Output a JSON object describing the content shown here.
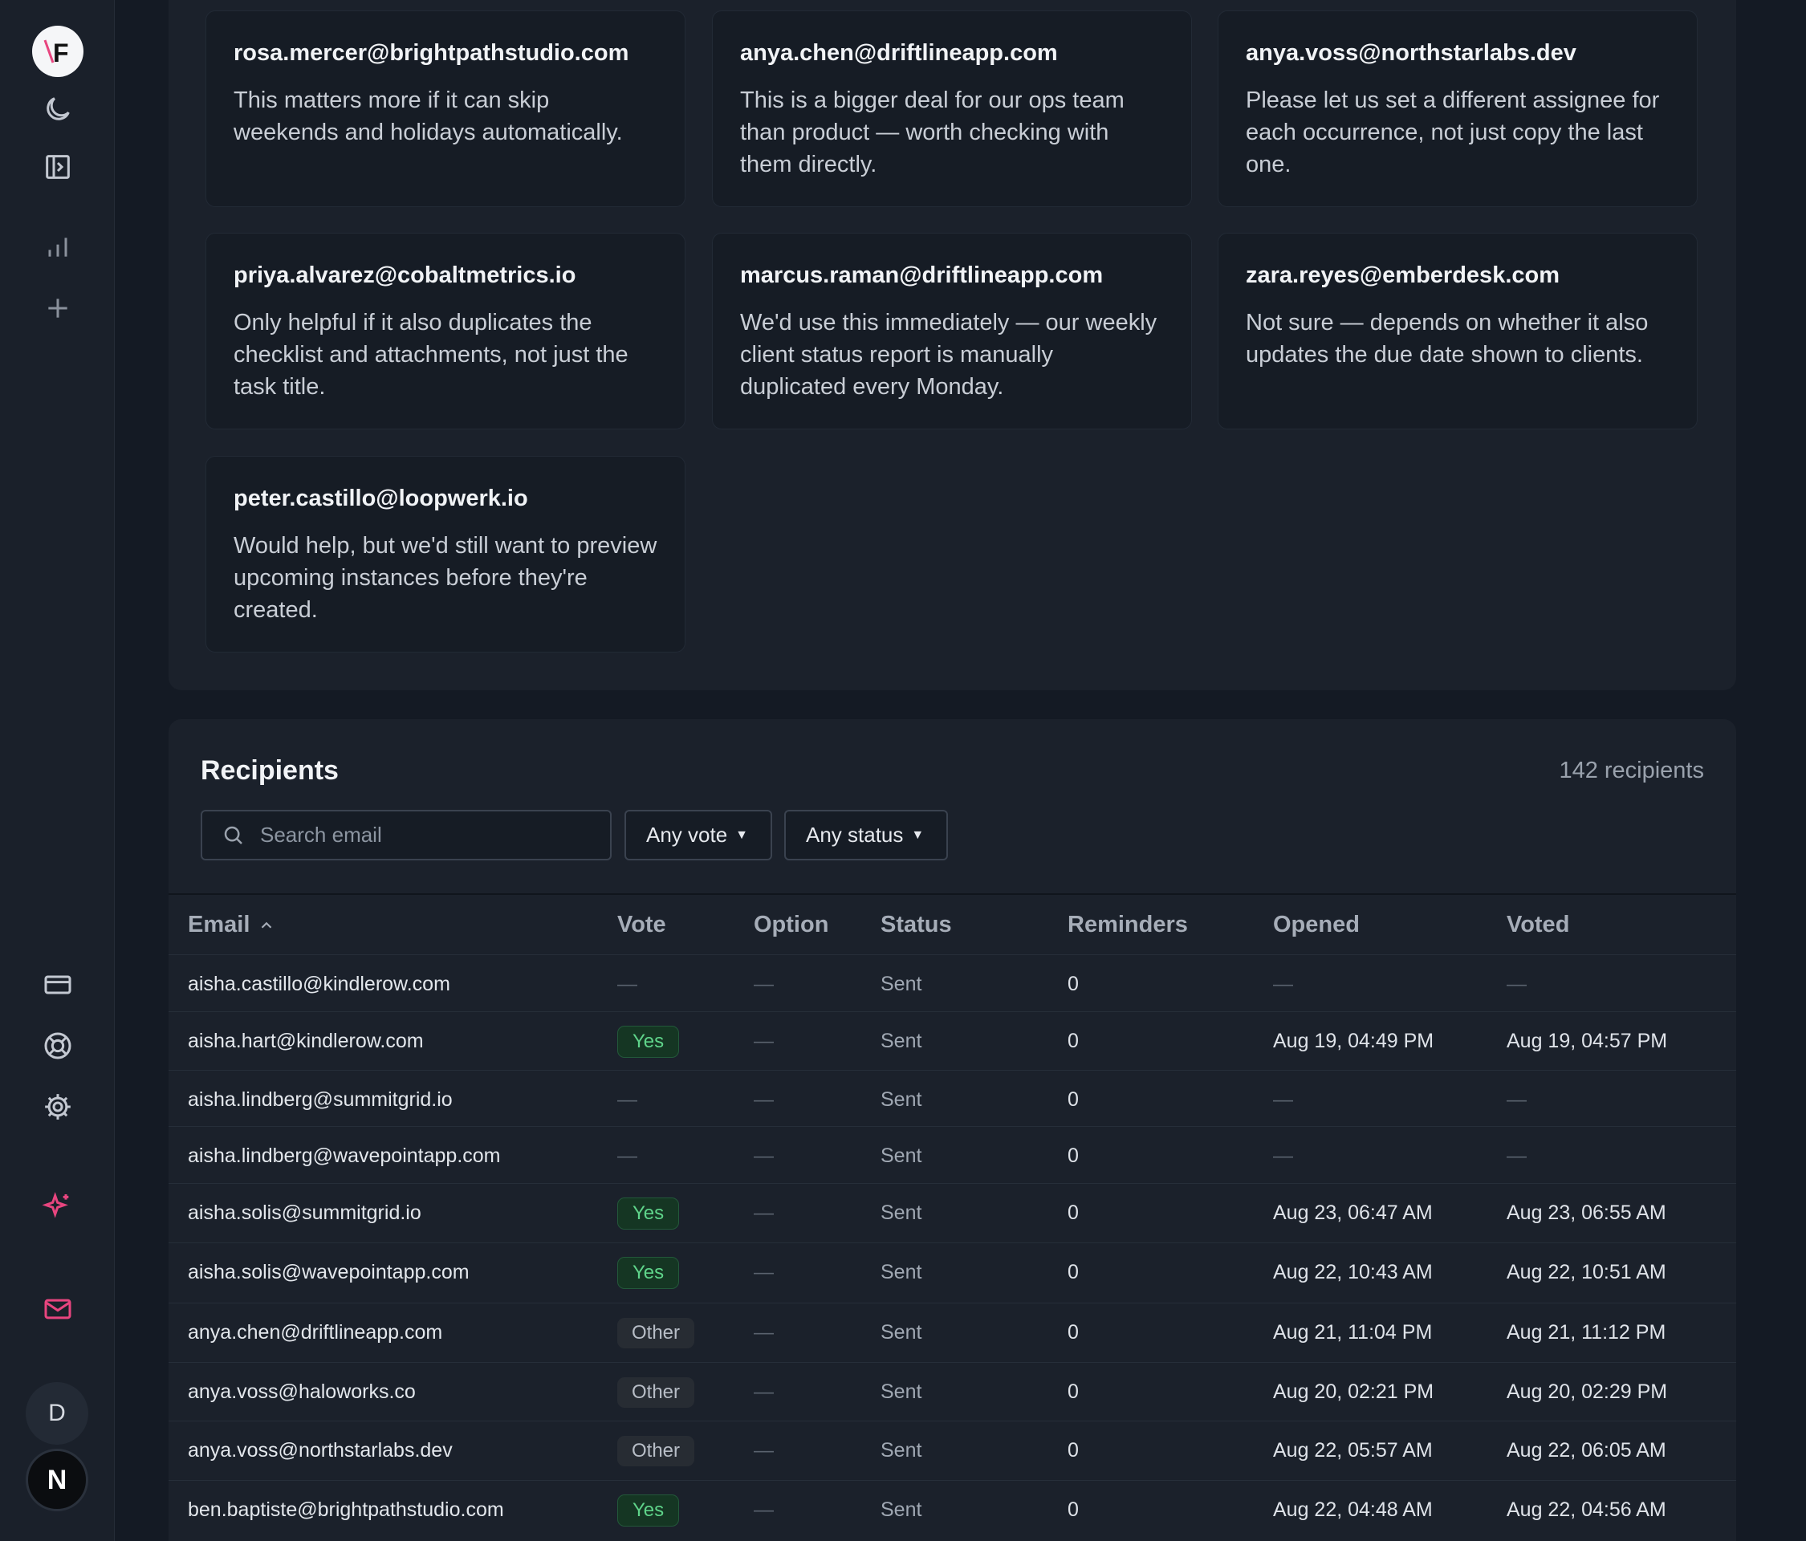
{
  "sidebar": {
    "logo_letter": "F",
    "avatars": [
      "D",
      "N"
    ]
  },
  "comments": [
    {
      "email": "rosa.mercer@brightpathstudio.com",
      "text": "This matters more if it can skip weekends and holidays automatically."
    },
    {
      "email": "anya.chen@driftlineapp.com",
      "text": "This is a bigger deal for our ops team than product — worth checking with them directly."
    },
    {
      "email": "anya.voss@northstarlabs.dev",
      "text": "Please let us set a different assignee for each occurrence, not just copy the last one."
    },
    {
      "email": "priya.alvarez@cobaltmetrics.io",
      "text": "Only helpful if it also duplicates the checklist and attachments, not just the task title."
    },
    {
      "email": "marcus.raman@driftlineapp.com",
      "text": "We'd use this immediately — our weekly client status report is manually duplicated every Monday."
    },
    {
      "email": "zara.reyes@emberdesk.com",
      "text": "Not sure — depends on whether it also updates the due date shown to clients."
    },
    {
      "email": "peter.castillo@loopwerk.io",
      "text": "Would help, but we'd still want to preview upcoming instances before they're created."
    }
  ],
  "recipients": {
    "title": "Recipients",
    "count_label": "142 recipients",
    "search_placeholder": "Search email",
    "filter_vote": "Any vote",
    "filter_status": "Any status",
    "columns": [
      "Email",
      "Vote",
      "Option",
      "Status",
      "Reminders",
      "Opened",
      "Voted"
    ],
    "rows": [
      {
        "email": "aisha.castillo@kindlerow.com",
        "vote": "—",
        "option": "—",
        "status": "Sent",
        "reminders": "0",
        "opened": "—",
        "voted": "—"
      },
      {
        "email": "aisha.hart@kindlerow.com",
        "vote": "Yes",
        "option": "—",
        "status": "Sent",
        "reminders": "0",
        "opened": "Aug 19, 04:49 PM",
        "voted": "Aug 19, 04:57 PM"
      },
      {
        "email": "aisha.lindberg@summitgrid.io",
        "vote": "—",
        "option": "—",
        "status": "Sent",
        "reminders": "0",
        "opened": "—",
        "voted": "—"
      },
      {
        "email": "aisha.lindberg@wavepointapp.com",
        "vote": "—",
        "option": "—",
        "status": "Sent",
        "reminders": "0",
        "opened": "—",
        "voted": "—"
      },
      {
        "email": "aisha.solis@summitgrid.io",
        "vote": "Yes",
        "option": "—",
        "status": "Sent",
        "reminders": "0",
        "opened": "Aug 23, 06:47 AM",
        "voted": "Aug 23, 06:55 AM"
      },
      {
        "email": "aisha.solis@wavepointapp.com",
        "vote": "Yes",
        "option": "—",
        "status": "Sent",
        "reminders": "0",
        "opened": "Aug 22, 10:43 AM",
        "voted": "Aug 22, 10:51 AM"
      },
      {
        "email": "anya.chen@driftlineapp.com",
        "vote": "Other",
        "option": "—",
        "status": "Sent",
        "reminders": "0",
        "opened": "Aug 21, 11:04 PM",
        "voted": "Aug 21, 11:12 PM"
      },
      {
        "email": "anya.voss@haloworks.co",
        "vote": "Other",
        "option": "—",
        "status": "Sent",
        "reminders": "0",
        "opened": "Aug 20, 02:21 PM",
        "voted": "Aug 20, 02:29 PM"
      },
      {
        "email": "anya.voss@northstarlabs.dev",
        "vote": "Other",
        "option": "—",
        "status": "Sent",
        "reminders": "0",
        "opened": "Aug 22, 05:57 AM",
        "voted": "Aug 22, 06:05 AM"
      },
      {
        "email": "ben.baptiste@brightpathstudio.com",
        "vote": "Yes",
        "option": "—",
        "status": "Sent",
        "reminders": "0",
        "opened": "Aug 22, 04:48 AM",
        "voted": "Aug 22, 04:56 AM"
      }
    ]
  },
  "colors": {
    "yes": "#5fd48a",
    "accent_pink": "#e8457f"
  }
}
